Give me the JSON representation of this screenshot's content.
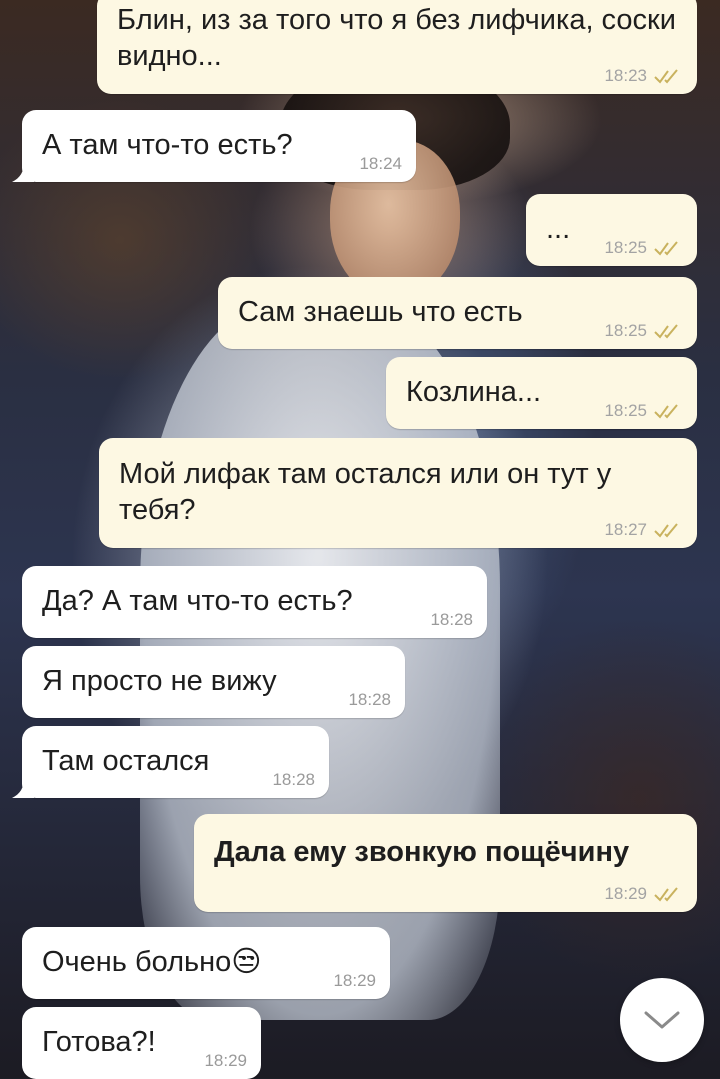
{
  "theme": {
    "incoming_bubble_color": "#ffffff",
    "outgoing_bubble_color": "#fdf8e3",
    "timestamp_color": "#a3a3a3",
    "read_tick_color": "#c9b25e"
  },
  "messages": [
    {
      "direction": "out",
      "text": "Блин, из за того что я без лифчика, соски видно...",
      "time": "18:23",
      "status": "read"
    },
    {
      "direction": "in",
      "text": "А там что-то есть?",
      "time": "18:24"
    },
    {
      "direction": "out",
      "text": "...",
      "time": "18:25",
      "status": "read"
    },
    {
      "direction": "out",
      "text": "Сам знаешь что есть",
      "time": "18:25",
      "status": "read"
    },
    {
      "direction": "out",
      "text": "Козлина...",
      "time": "18:25",
      "status": "read"
    },
    {
      "direction": "out",
      "text": "Мой лифак там остался или он тут у тебя?",
      "time": "18:27",
      "status": "read"
    },
    {
      "direction": "in",
      "text": "Да? А там что-то есть?",
      "time": "18:28"
    },
    {
      "direction": "in",
      "text": "Я просто не вижу",
      "time": "18:28"
    },
    {
      "direction": "in",
      "text": "Там остался",
      "time": "18:28"
    },
    {
      "direction": "out",
      "text": "Дала ему звонкую пощёчину",
      "time": "18:29",
      "status": "read",
      "bold": true
    },
    {
      "direction": "in",
      "text": "Очень больно",
      "emoji": "😒",
      "time": "18:29"
    },
    {
      "direction": "in",
      "text": "Готова?!",
      "time": "18:29"
    }
  ],
  "scroll_button": {
    "icon": "chevron-down-icon"
  },
  "wallpaper": {
    "icon": "chat-background-photo"
  }
}
